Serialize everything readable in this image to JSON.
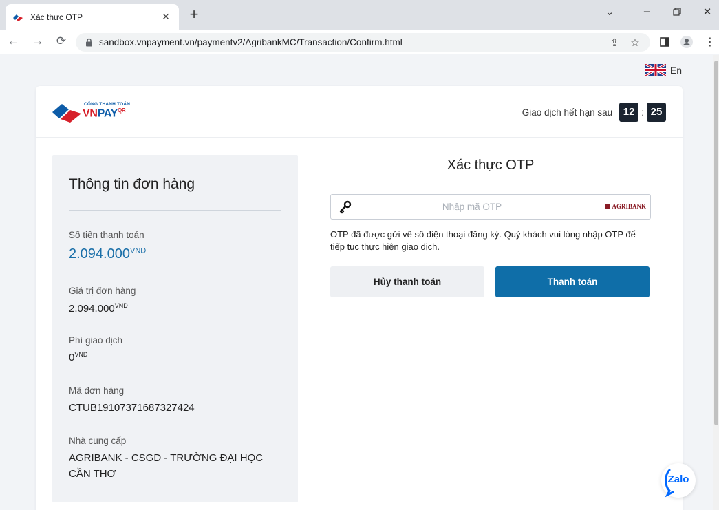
{
  "browser": {
    "tab_title": "Xác thực OTP",
    "url": "sandbox.vnpayment.vn/paymentv2/AgribankMC/Transaction/Confirm.html"
  },
  "page": {
    "language": "En",
    "expire_label": "Giao dịch hết hạn sau",
    "timer_minutes": "12",
    "timer_sep": ":",
    "timer_seconds": "25",
    "logo_top": "CỔNG THANH TOÁN",
    "logo_vn": "VN",
    "logo_pay": "PAY",
    "logo_qr": "QR",
    "zalo": "Zalo"
  },
  "order": {
    "title": "Thông tin đơn hàng",
    "amount_label": "Số tiền thanh toán",
    "amount_value": "2.094.000",
    "currency": "VND",
    "order_value_label": "Giá trị đơn hàng",
    "order_value": "2.094.000",
    "fee_label": "Phí giao dịch",
    "fee_value": "0",
    "order_id_label": "Mã đơn hàng",
    "order_id": "CTUB19107371687327424",
    "provider_label": "Nhà cung cấp",
    "provider_line1": "AGRIBANK - CSGD - TRƯỜNG ĐẠI HỌC",
    "provider_line2": "CẦN THƠ"
  },
  "otp": {
    "title": "Xác thực OTP",
    "placeholder": "Nhập mã OTP",
    "bank": "AGRIBANK",
    "note": "OTP đã được gửi về số điện thoại đăng ký. Quý khách vui lòng nhập OTP để tiếp tục thực hiện giao dịch.",
    "cancel_label": "Hủy thanh toán",
    "pay_label": "Thanh toán"
  },
  "colors": {
    "primary": "#0f6ea8",
    "amount": "#1a6fa8",
    "timer_bg": "#1b2430",
    "agribank": "#8a1c26"
  }
}
